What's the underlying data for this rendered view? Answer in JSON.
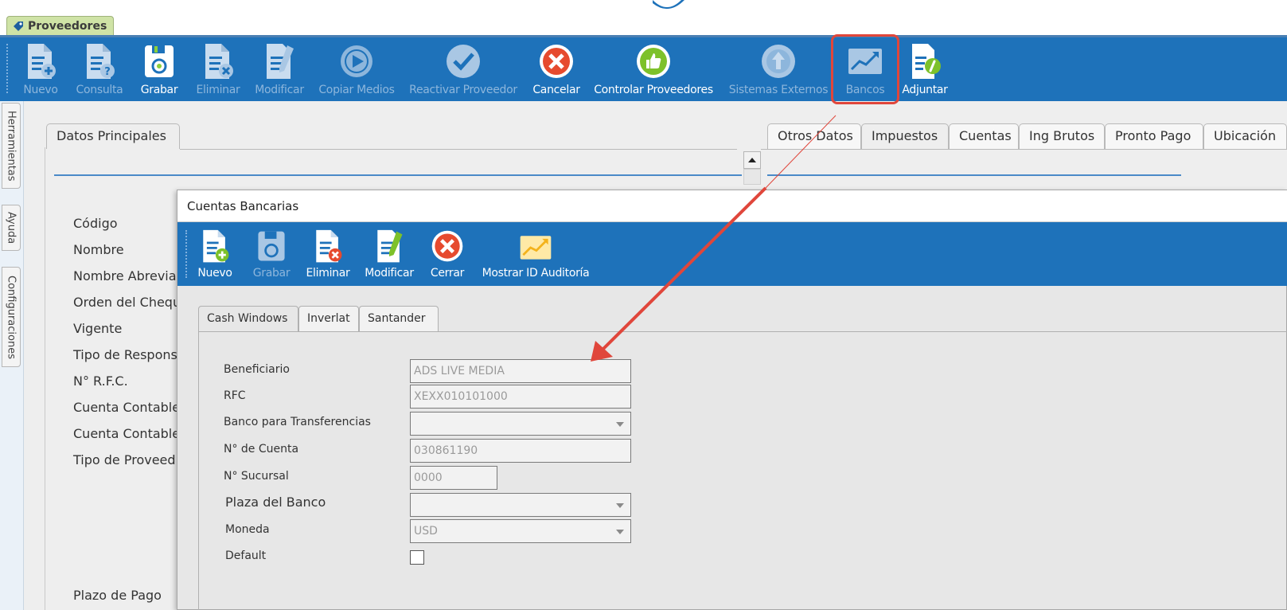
{
  "window": {
    "tab_label": "Proveedores"
  },
  "main_toolbar": {
    "buttons": [
      {
        "label": "Nuevo",
        "enabled": false,
        "icon": "document-add-icon"
      },
      {
        "label": "Consulta",
        "enabled": false,
        "icon": "document-query-icon"
      },
      {
        "label": "Grabar",
        "enabled": true,
        "icon": "save-icon"
      },
      {
        "label": "Eliminar",
        "enabled": false,
        "icon": "document-delete-icon"
      },
      {
        "label": "Modificar",
        "enabled": false,
        "icon": "document-edit-icon"
      },
      {
        "label": "Copiar Medios",
        "enabled": false,
        "icon": "play-circle-icon"
      },
      {
        "label": "Reactivar Proveedor",
        "enabled": false,
        "icon": "check-circle-icon"
      },
      {
        "label": "Cancelar",
        "enabled": true,
        "icon": "cancel-icon"
      },
      {
        "label": "Controlar Proveedores",
        "enabled": true,
        "icon": "thumbs-up-icon"
      },
      {
        "label": "Sistemas Externos",
        "enabled": false,
        "icon": "external-systems-icon"
      },
      {
        "label": "Bancos",
        "enabled": false,
        "icon": "chart-up-icon"
      },
      {
        "label": "Adjuntar",
        "enabled": true,
        "icon": "attach-icon"
      }
    ]
  },
  "side_tabs": [
    "Herramientas",
    "Ayuda",
    "Configuraciones"
  ],
  "panel_tabs": {
    "left": "Datos Principales",
    "right": [
      "Otros Datos",
      "Impuestos",
      "Cuentas",
      "Ing Brutos",
      "Pronto Pago",
      "Ubicación"
    ]
  },
  "main_fields": [
    "Código",
    "Nombre",
    "Nombre Abrevia",
    "Orden del Chequ",
    "Vigente",
    "Tipo de Respons",
    "N° R.F.C.",
    "Cuenta Contable",
    "Cuenta Contable",
    "Tipo de Proveed",
    "Plazo de Pago"
  ],
  "dialog": {
    "title": "Cuentas Bancarias",
    "toolbar": [
      {
        "label": "Nuevo",
        "enabled": true,
        "icon": "document-add-icon"
      },
      {
        "label": "Grabar",
        "enabled": false,
        "icon": "save-icon"
      },
      {
        "label": "Eliminar",
        "enabled": true,
        "icon": "document-delete-icon"
      },
      {
        "label": "Modificar",
        "enabled": true,
        "icon": "document-edit-icon"
      },
      {
        "label": "Cerrar",
        "enabled": true,
        "icon": "close-circle-icon"
      },
      {
        "label": "Mostrar ID Auditoría",
        "enabled": true,
        "icon": "chart-up-icon"
      }
    ],
    "tabs": [
      "Cash Windows",
      "Inverlat",
      "Santander"
    ],
    "form": {
      "beneficiario": {
        "label": "Beneficiario",
        "value": "ADS LIVE MEDIA"
      },
      "rfc": {
        "label": "RFC",
        "value": "XEXX010101000"
      },
      "banco": {
        "label": "Banco para Transferencias",
        "value": ""
      },
      "cuenta": {
        "label": "N° de Cuenta",
        "value": "030861190"
      },
      "sucursal": {
        "label": "N° Sucursal",
        "value": "0000"
      },
      "plaza": {
        "label": "Plaza del Banco",
        "value": ""
      },
      "moneda": {
        "label": "Moneda",
        "value": "USD"
      },
      "default": {
        "label": "Default",
        "checked": false
      }
    }
  },
  "colors": {
    "toolbar": "#1e72ba",
    "annotation": "#e0463b",
    "tab_green": "#cfe3a6"
  }
}
